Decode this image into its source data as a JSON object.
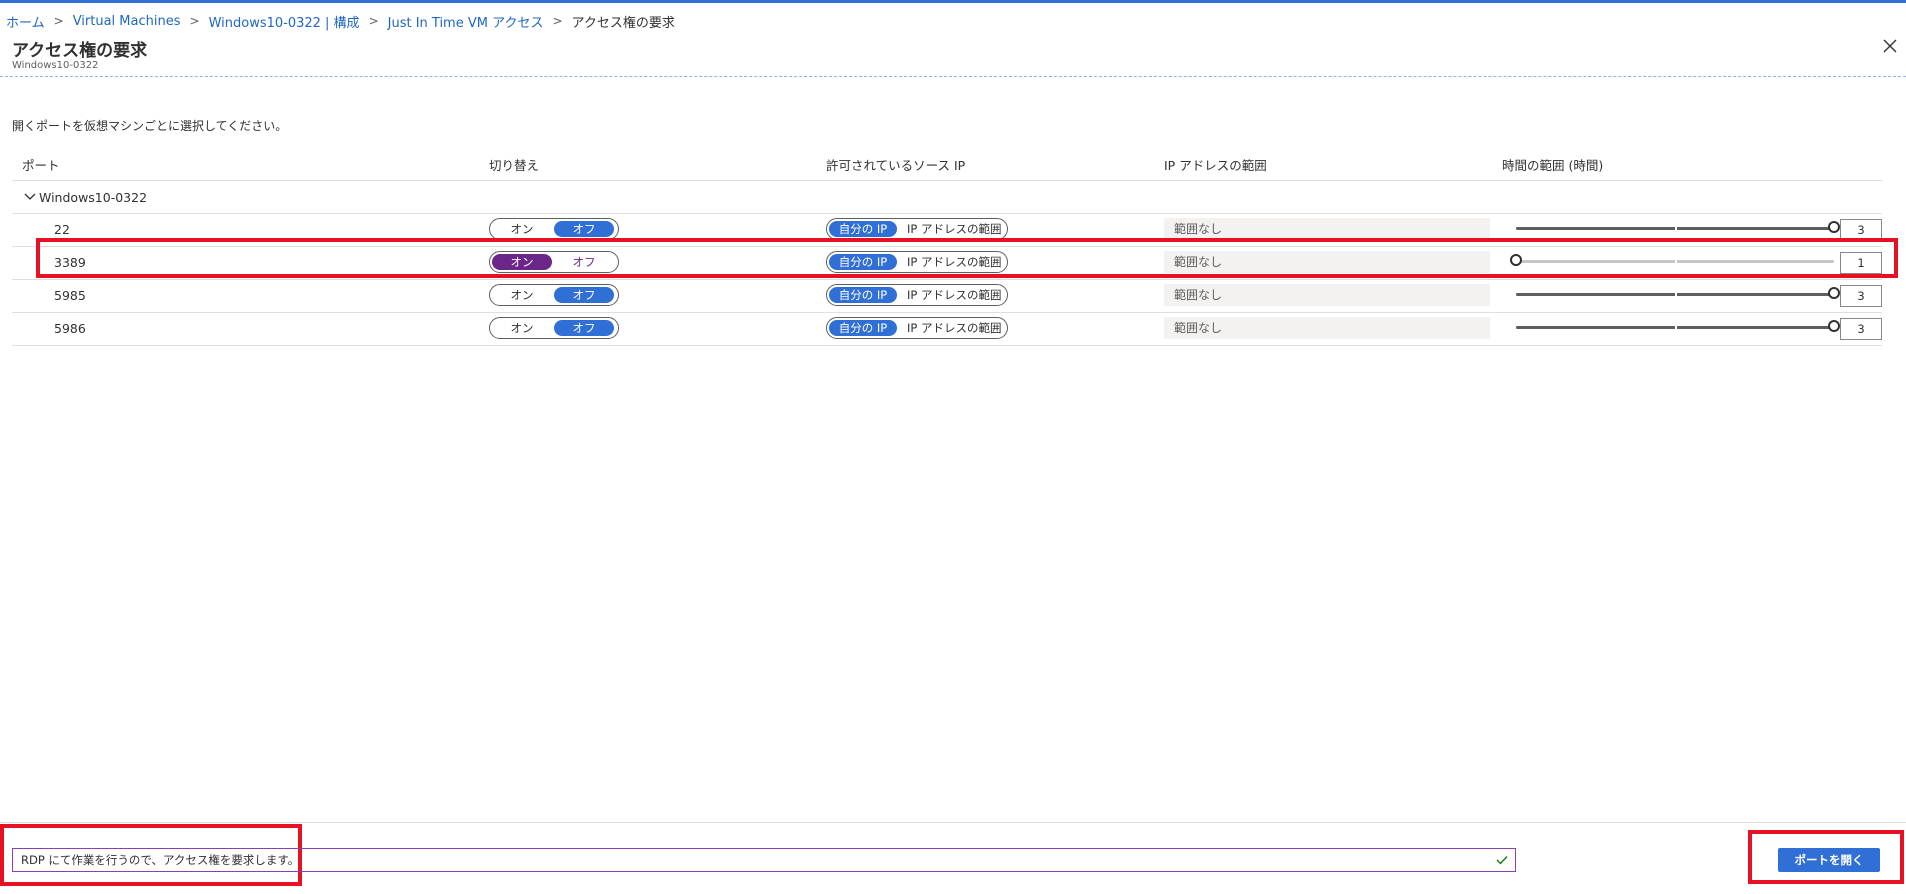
{
  "breadcrumb": [
    {
      "label": "ホーム"
    },
    {
      "label": "Virtual Machines"
    },
    {
      "label": "Windows10-0322 | 構成"
    },
    {
      "label": "Just In Time VM アクセス"
    },
    {
      "label": "アクセス権の要求"
    }
  ],
  "header": {
    "title": "アクセス権の要求",
    "subtitle": "Windows10-0322",
    "close_icon": "close-icon"
  },
  "instruction": "開くポートを仮想マシンごとに選択してください。",
  "columns": {
    "port": "ポート",
    "toggle": "切り替え",
    "source_ip": "許可されているソース IP",
    "ip_range": "IP アドレスの範囲",
    "time_range": "時間の範囲 (時間)"
  },
  "group": {
    "name": "Windows10-0322",
    "icon": "chevron-down-icon"
  },
  "rows": [
    {
      "port": "22",
      "toggle_on": "オン",
      "toggle_off": "オフ",
      "state": "off",
      "source_primary": "自分の IP",
      "source_alt": "IP アドレスの範囲",
      "ip_range": "範囲なし",
      "hours": "3",
      "hours_level": 1.0
    },
    {
      "port": "3389",
      "toggle_on": "オン",
      "toggle_off": "オフ",
      "state": "on",
      "source_primary": "自分の IP",
      "source_alt": "IP アドレスの範囲",
      "ip_range": "範囲なし",
      "hours": "1",
      "hours_level": 0.0
    },
    {
      "port": "5985",
      "toggle_on": "オン",
      "toggle_off": "オフ",
      "state": "off",
      "source_primary": "自分の IP",
      "source_alt": "IP アドレスの範囲",
      "ip_range": "範囲なし",
      "hours": "3",
      "hours_level": 1.0
    },
    {
      "port": "5986",
      "toggle_on": "オン",
      "toggle_off": "オフ",
      "state": "off",
      "source_primary": "自分の IP",
      "source_alt": "IP アドレスの範囲",
      "ip_range": "範囲なし",
      "hours": "3",
      "hours_level": 1.0
    }
  ],
  "footer": {
    "justification": "RDP にて作業を行うので、アクセス権を要求します。",
    "valid_icon": "checkmark-icon",
    "open_button": "ポートを開く"
  },
  "colors": {
    "accent": "#2f6fd6",
    "toggle_on": "#6b2689",
    "highlight": "#e81123"
  }
}
